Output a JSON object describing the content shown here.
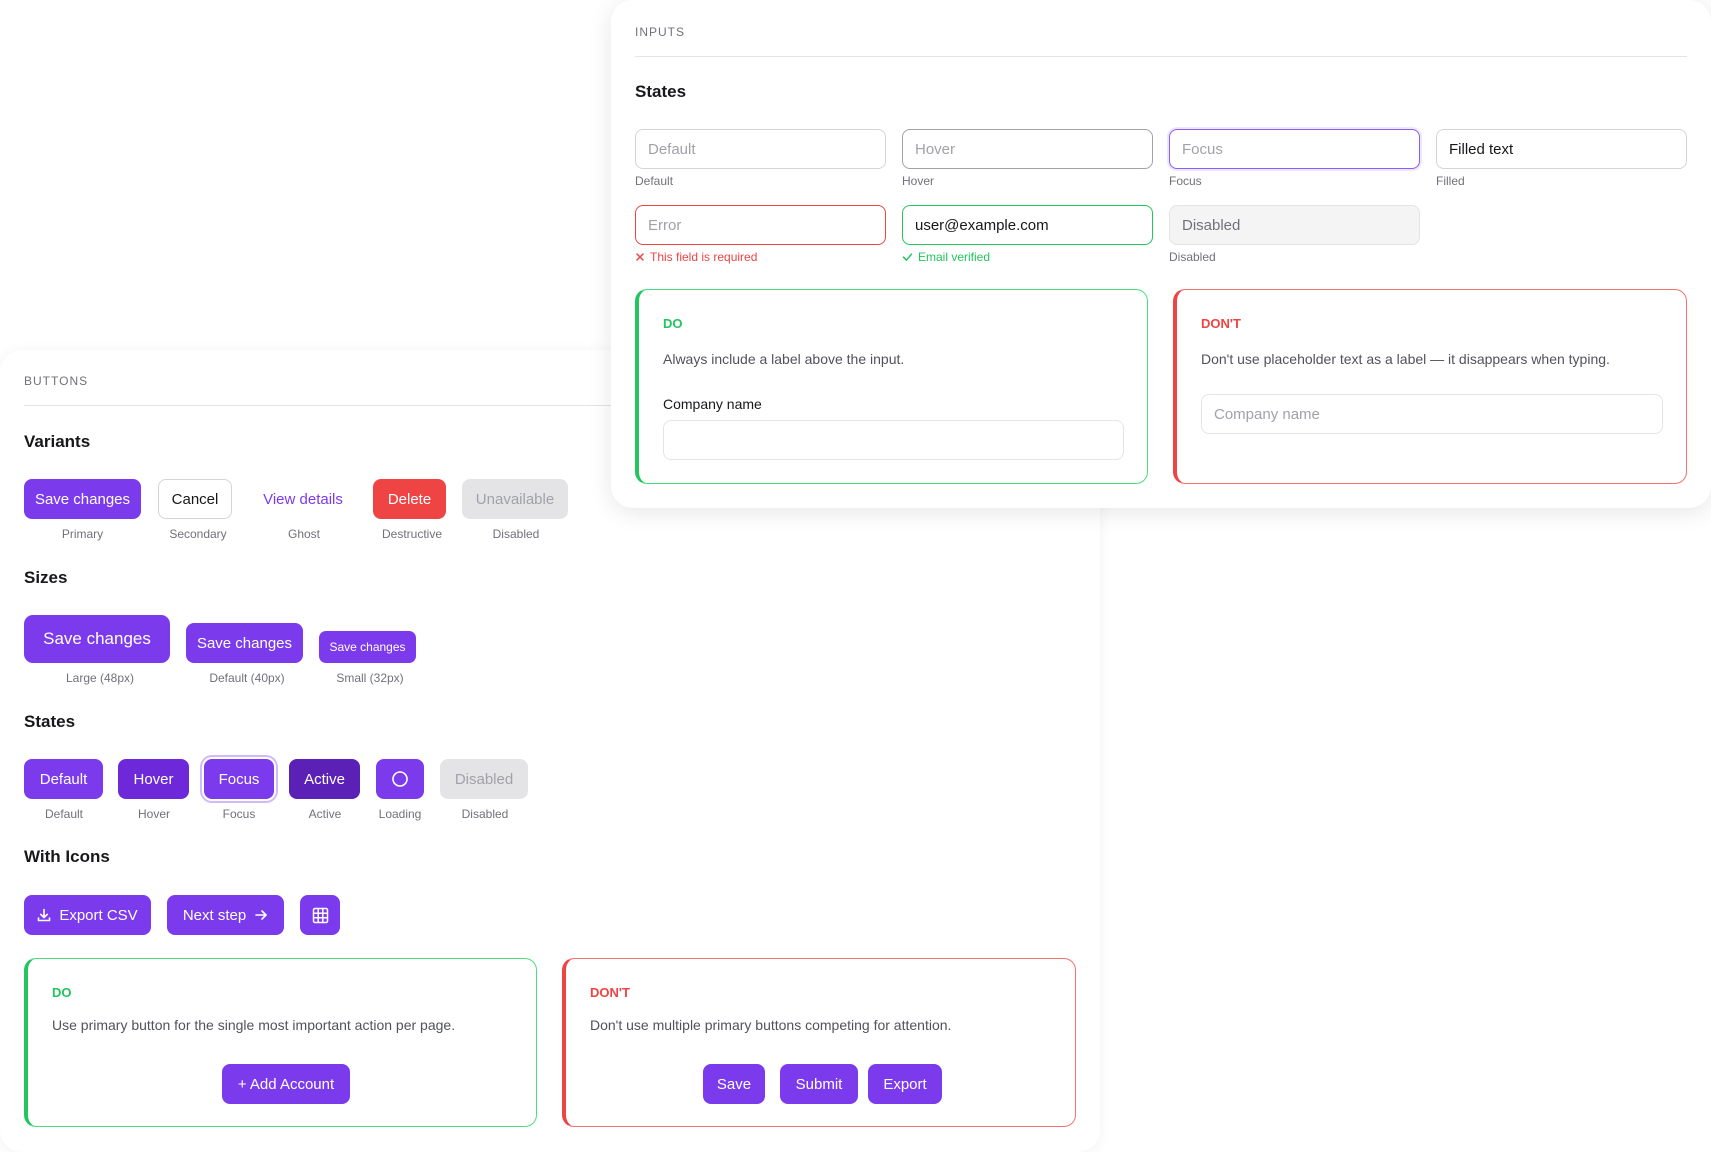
{
  "buttons_section": {
    "label": "BUTTONS",
    "variants": {
      "heading": "Variants",
      "items": [
        {
          "text": "Save changes",
          "caption": "Primary"
        },
        {
          "text": "Cancel",
          "caption": "Secondary"
        },
        {
          "text": "View details",
          "caption": "Ghost"
        },
        {
          "text": "Delete",
          "caption": "Destructive"
        },
        {
          "text": "Unavailable",
          "caption": "Disabled"
        }
      ]
    },
    "sizes": {
      "heading": "Sizes",
      "items": [
        {
          "text": "Save changes",
          "caption": "Large (48px)"
        },
        {
          "text": "Save changes",
          "caption": "Default (40px)"
        },
        {
          "text": "Save changes",
          "caption": "Small (32px)"
        }
      ]
    },
    "states": {
      "heading": "States",
      "items": [
        {
          "text": "Default",
          "caption": "Default"
        },
        {
          "text": "Hover",
          "caption": "Hover"
        },
        {
          "text": "Focus",
          "caption": "Focus"
        },
        {
          "text": "Active",
          "caption": "Active"
        },
        {
          "text": "",
          "caption": "Loading",
          "icon": "spinner-icon"
        },
        {
          "text": "Disabled",
          "caption": "Disabled"
        }
      ]
    },
    "with_icons": {
      "heading": "With Icons",
      "items": [
        {
          "text": "Export CSV",
          "icon": "download-icon"
        },
        {
          "text": "Next step",
          "icon": "arrow-right-icon"
        },
        {
          "text": "",
          "icon": "grid-icon"
        }
      ]
    },
    "do": {
      "title": "DO",
      "text": "Use primary button for the single most important action per page.",
      "button": "+ Add Account"
    },
    "dont": {
      "title": "DON'T",
      "text": "Don't use multiple primary buttons competing for attention.",
      "buttons": [
        "Save",
        "Submit",
        "Export"
      ]
    }
  },
  "inputs_section": {
    "label": "INPUTS",
    "states_heading": "States",
    "fields": [
      {
        "value": "Default",
        "caption": "Default"
      },
      {
        "value": "Hover",
        "caption": "Hover"
      },
      {
        "value": "Focus",
        "caption": "Focus"
      },
      {
        "value": "Filled text",
        "caption": "Filled"
      },
      {
        "value": "Error",
        "helper": "This field is required",
        "helper_icon": "x-icon"
      },
      {
        "value": "user@example.com",
        "helper": "Email verified",
        "helper_icon": "check-icon"
      },
      {
        "value": "Disabled",
        "caption": "Disabled"
      }
    ],
    "do": {
      "title": "DO",
      "text": "Always include a label above the input.",
      "field_label": "Company name",
      "field_value": ""
    },
    "dont": {
      "title": "DON'T",
      "text": "Don't use placeholder text as a label — it disappears when typing.",
      "field_placeholder": "Company name"
    }
  },
  "colors": {
    "primary": "#7c3aed",
    "primary_hover": "#6d28d9",
    "primary_active": "#5b21b6",
    "destructive": "#ef4444",
    "success": "#22c55e",
    "disabled_bg": "#e4e4e7"
  }
}
